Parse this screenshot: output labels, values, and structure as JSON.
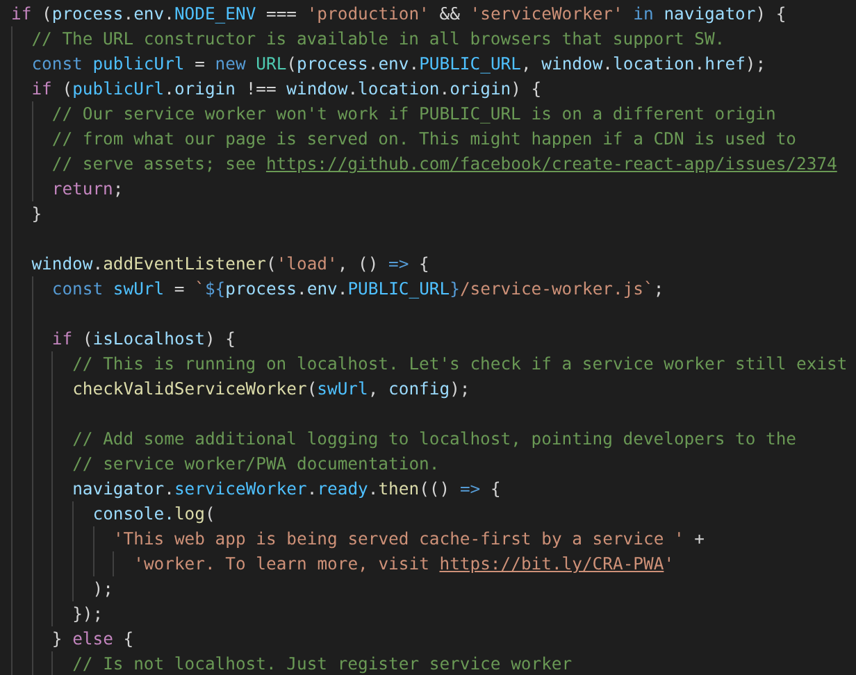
{
  "editor": {
    "lines": [
      {
        "kind": "code",
        "tokens": [
          {
            "kind": "keyword",
            "text": "if"
          },
          {
            "kind": "plain",
            "text": " ("
          },
          {
            "kind": "variable",
            "text": "process"
          },
          {
            "kind": "plain",
            "text": "."
          },
          {
            "kind": "variable",
            "text": "env"
          },
          {
            "kind": "plain",
            "text": "."
          },
          {
            "kind": "constant",
            "text": "NODE_ENV"
          },
          {
            "kind": "plain",
            "text": " === "
          },
          {
            "kind": "string",
            "text": "'production'"
          },
          {
            "kind": "plain",
            "text": " && "
          },
          {
            "kind": "string",
            "text": "'serviceWorker'"
          },
          {
            "kind": "storage",
            "text": " in "
          },
          {
            "kind": "variable",
            "text": "navigator"
          },
          {
            "kind": "plain",
            "text": ") {"
          }
        ],
        "children": [
          {
            "kind": "code",
            "tokens": [
              {
                "kind": "comment",
                "text": "// The URL constructor is available in all browsers that support SW."
              }
            ]
          },
          {
            "kind": "code",
            "tokens": [
              {
                "kind": "storage",
                "text": "const "
              },
              {
                "kind": "constant",
                "text": "publicUrl"
              },
              {
                "kind": "plain",
                "text": " = "
              },
              {
                "kind": "storage",
                "text": "new "
              },
              {
                "kind": "class",
                "text": "URL"
              },
              {
                "kind": "plain",
                "text": "("
              },
              {
                "kind": "variable",
                "text": "process"
              },
              {
                "kind": "plain",
                "text": "."
              },
              {
                "kind": "variable",
                "text": "env"
              },
              {
                "kind": "plain",
                "text": "."
              },
              {
                "kind": "constant",
                "text": "PUBLIC_URL"
              },
              {
                "kind": "plain",
                "text": ", "
              },
              {
                "kind": "variable",
                "text": "window"
              },
              {
                "kind": "plain",
                "text": "."
              },
              {
                "kind": "variable",
                "text": "location"
              },
              {
                "kind": "plain",
                "text": "."
              },
              {
                "kind": "variable",
                "text": "href"
              },
              {
                "kind": "plain",
                "text": ");"
              }
            ]
          },
          {
            "kind": "code",
            "tokens": [
              {
                "kind": "keyword",
                "text": "if"
              },
              {
                "kind": "plain",
                "text": " ("
              },
              {
                "kind": "constant",
                "text": "publicUrl"
              },
              {
                "kind": "plain",
                "text": "."
              },
              {
                "kind": "variable",
                "text": "origin"
              },
              {
                "kind": "plain",
                "text": " !== "
              },
              {
                "kind": "variable",
                "text": "window"
              },
              {
                "kind": "plain",
                "text": "."
              },
              {
                "kind": "variable",
                "text": "location"
              },
              {
                "kind": "plain",
                "text": "."
              },
              {
                "kind": "variable",
                "text": "origin"
              },
              {
                "kind": "plain",
                "text": ") {"
              }
            ],
            "children": [
              {
                "kind": "code",
                "tokens": [
                  {
                    "kind": "comment",
                    "text": "// Our service worker won't work if PUBLIC_URL is on a different origin"
                  }
                ]
              },
              {
                "kind": "code",
                "tokens": [
                  {
                    "kind": "comment",
                    "text": "// from what our page is served on. This might happen if a CDN is used to"
                  }
                ]
              },
              {
                "kind": "code",
                "tokens": [
                  {
                    "kind": "comment",
                    "text": "// serve assets; see "
                  },
                  {
                    "kind": "link",
                    "text": "https://github.com/facebook/create-react-app/issues/2374"
                  }
                ]
              },
              {
                "kind": "code",
                "tokens": [
                  {
                    "kind": "keyword",
                    "text": "return"
                  },
                  {
                    "kind": "plain",
                    "text": ";"
                  }
                ]
              }
            ]
          },
          {
            "kind": "code",
            "tokens": [
              {
                "kind": "plain",
                "text": "}"
              }
            ]
          },
          {
            "kind": "blank"
          },
          {
            "kind": "code",
            "tokens": [
              {
                "kind": "variable",
                "text": "window"
              },
              {
                "kind": "plain",
                "text": "."
              },
              {
                "kind": "function",
                "text": "addEventListener"
              },
              {
                "kind": "plain",
                "text": "("
              },
              {
                "kind": "string",
                "text": "'load'"
              },
              {
                "kind": "plain",
                "text": ", () "
              },
              {
                "kind": "storage",
                "text": "=>"
              },
              {
                "kind": "plain",
                "text": " {"
              }
            ],
            "children": [
              {
                "kind": "code",
                "tokens": [
                  {
                    "kind": "storage",
                    "text": "const "
                  },
                  {
                    "kind": "constant",
                    "text": "swUrl"
                  },
                  {
                    "kind": "plain",
                    "text": " = "
                  },
                  {
                    "kind": "string",
                    "text": "`"
                  },
                  {
                    "kind": "storage",
                    "text": "${"
                  },
                  {
                    "kind": "variable",
                    "text": "process"
                  },
                  {
                    "kind": "plain",
                    "text": "."
                  },
                  {
                    "kind": "variable",
                    "text": "env"
                  },
                  {
                    "kind": "plain",
                    "text": "."
                  },
                  {
                    "kind": "constant",
                    "text": "PUBLIC_URL"
                  },
                  {
                    "kind": "storage",
                    "text": "}"
                  },
                  {
                    "kind": "string",
                    "text": "/service-worker.js`"
                  },
                  {
                    "kind": "plain",
                    "text": ";"
                  }
                ]
              },
              {
                "kind": "blank"
              },
              {
                "kind": "code",
                "tokens": [
                  {
                    "kind": "keyword",
                    "text": "if"
                  },
                  {
                    "kind": "plain",
                    "text": " ("
                  },
                  {
                    "kind": "variable",
                    "text": "isLocalhost"
                  },
                  {
                    "kind": "plain",
                    "text": ") {"
                  }
                ],
                "children": [
                  {
                    "kind": "code",
                    "tokens": [
                      {
                        "kind": "comment",
                        "text": "// This is running on localhost. Let's check if a service worker still exist"
                      }
                    ]
                  },
                  {
                    "kind": "code",
                    "tokens": [
                      {
                        "kind": "function",
                        "text": "checkValidServiceWorker"
                      },
                      {
                        "kind": "plain",
                        "text": "("
                      },
                      {
                        "kind": "constant",
                        "text": "swUrl"
                      },
                      {
                        "kind": "plain",
                        "text": ", "
                      },
                      {
                        "kind": "variable",
                        "text": "config"
                      },
                      {
                        "kind": "plain",
                        "text": ");"
                      }
                    ]
                  },
                  {
                    "kind": "blank"
                  },
                  {
                    "kind": "code",
                    "tokens": [
                      {
                        "kind": "comment",
                        "text": "// Add some additional logging to localhost, pointing developers to the"
                      }
                    ]
                  },
                  {
                    "kind": "code",
                    "tokens": [
                      {
                        "kind": "comment",
                        "text": "// service worker/PWA documentation."
                      }
                    ]
                  },
                  {
                    "kind": "code",
                    "tokens": [
                      {
                        "kind": "variable",
                        "text": "navigator"
                      },
                      {
                        "kind": "plain",
                        "text": "."
                      },
                      {
                        "kind": "constant",
                        "text": "serviceWorker"
                      },
                      {
                        "kind": "plain",
                        "text": "."
                      },
                      {
                        "kind": "constant",
                        "text": "ready"
                      },
                      {
                        "kind": "plain",
                        "text": "."
                      },
                      {
                        "kind": "function",
                        "text": "then"
                      },
                      {
                        "kind": "plain",
                        "text": "(() "
                      },
                      {
                        "kind": "storage",
                        "text": "=>"
                      },
                      {
                        "kind": "plain",
                        "text": " {"
                      }
                    ],
                    "children": [
                      {
                        "kind": "code",
                        "tokens": [
                          {
                            "kind": "variable",
                            "text": "console."
                          },
                          {
                            "kind": "function",
                            "text": "log"
                          },
                          {
                            "kind": "plain",
                            "text": "("
                          }
                        ],
                        "children": [
                          {
                            "kind": "code",
                            "tokens": [
                              {
                                "kind": "string",
                                "text": "'This web app is being served cache-first by a service '"
                              },
                              {
                                "kind": "plain",
                                "text": " +"
                              }
                            ],
                            "children": [
                              {
                                "kind": "code",
                                "tokens": [
                                  {
                                    "kind": "string",
                                    "text": "'worker. To learn more, visit "
                                  },
                                  {
                                    "kind": "string-link",
                                    "text": "https://bit.ly/CRA-PWA"
                                  },
                                  {
                                    "kind": "string",
                                    "text": "'"
                                  }
                                ]
                              }
                            ]
                          }
                        ]
                      },
                      {
                        "kind": "code",
                        "tokens": [
                          {
                            "kind": "plain",
                            "text": ");"
                          }
                        ]
                      }
                    ]
                  },
                  {
                    "kind": "code",
                    "tokens": [
                      {
                        "kind": "plain",
                        "text": "});"
                      }
                    ]
                  }
                ]
              },
              {
                "kind": "code",
                "tokens": [
                  {
                    "kind": "plain",
                    "text": "} "
                  },
                  {
                    "kind": "keyword",
                    "text": "else"
                  },
                  {
                    "kind": "plain",
                    "text": " {"
                  }
                ],
                "children": [
                  {
                    "kind": "code",
                    "tokens": [
                      {
                        "kind": "comment",
                        "text": "// Is not localhost. Just register service worker"
                      }
                    ]
                  }
                ]
              }
            ]
          }
        ]
      }
    ]
  }
}
